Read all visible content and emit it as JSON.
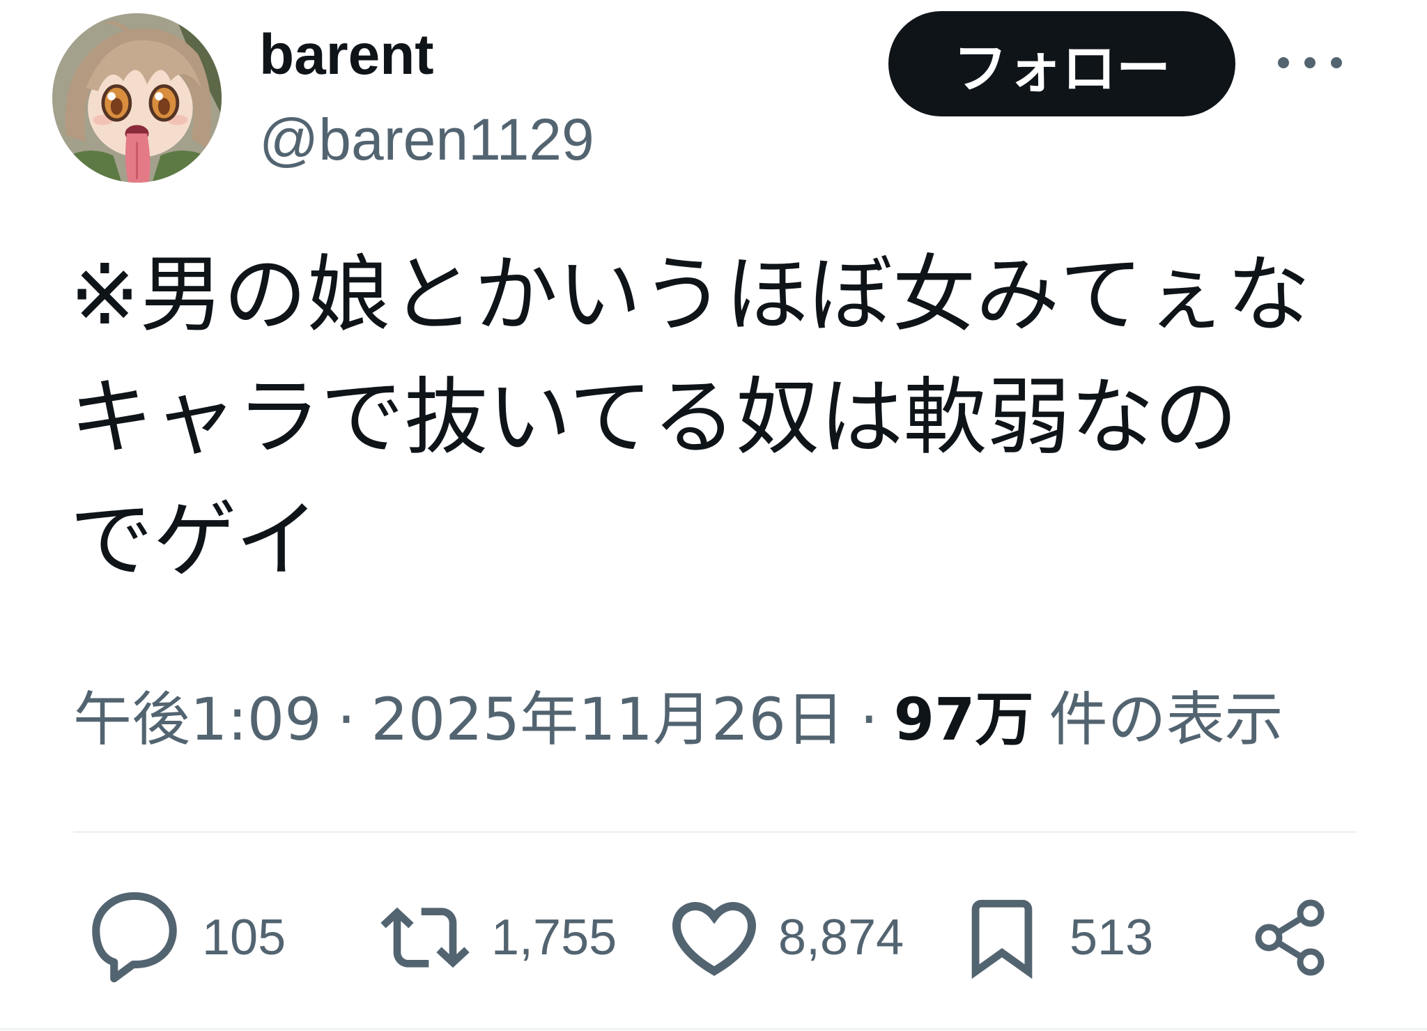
{
  "author": {
    "name": "barent",
    "handle": "@baren1129",
    "avatar_icon": "avatar-image"
  },
  "follow_button": {
    "label": "フォロー"
  },
  "more_button": {
    "icon": "more-horizontal-icon"
  },
  "tweet": {
    "text_lines": [
      "※男の娘とかいうほぼ女みてぇな",
      "キャラで抜いてる奴は軟弱なの",
      "でゲイ"
    ]
  },
  "meta": {
    "time": "午後1:09",
    "sep1": "·",
    "date": "2025年11月26日",
    "sep2": "·",
    "views_count": "97万",
    "views_label": "件の表示"
  },
  "actions": {
    "reply": {
      "icon": "reply-icon",
      "count": "105"
    },
    "retweet": {
      "icon": "retweet-icon",
      "count": "1,755"
    },
    "like": {
      "icon": "heart-icon",
      "count": "8,874"
    },
    "bookmark": {
      "icon": "bookmark-icon",
      "count": "513"
    },
    "share": {
      "icon": "share-icon"
    }
  },
  "colors": {
    "text": "#0f1419",
    "secondary": "#536471",
    "button_bg": "#0f1419",
    "button_text": "#ffffff",
    "divider": "#eff3f4"
  }
}
